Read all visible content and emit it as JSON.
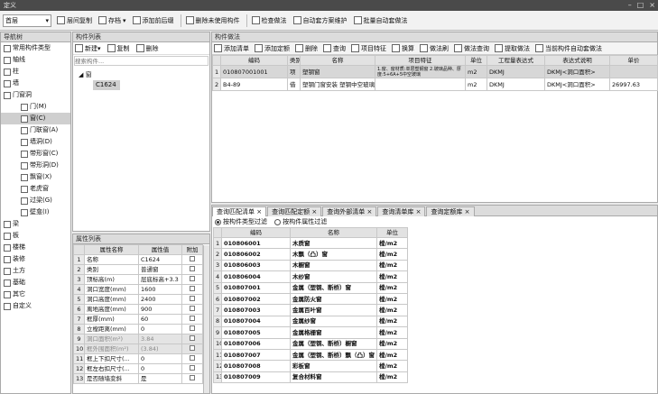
{
  "window": {
    "title": "定义"
  },
  "toolbar": {
    "floor_value": "首层",
    "buttons": [
      "层间复制",
      "存档",
      "添加前后缀",
      "删除未使用构件",
      "检查做法",
      "自动套方案维护",
      "批量自动套做法"
    ]
  },
  "nav": {
    "title": "导航树",
    "items": [
      {
        "label": "常用构件类型",
        "level": 0
      },
      {
        "label": "轴线",
        "level": 0
      },
      {
        "label": "柱",
        "level": 0
      },
      {
        "label": "墙",
        "level": 0
      },
      {
        "label": "门窗洞",
        "level": 0
      },
      {
        "label": "门(M)",
        "level": 1
      },
      {
        "label": "窗(C)",
        "level": 1
      },
      {
        "label": "门联窗(A)",
        "level": 1
      },
      {
        "label": "墙洞(D)",
        "level": 1
      },
      {
        "label": "带形窗(C)",
        "level": 1
      },
      {
        "label": "带形洞(D)",
        "level": 1
      },
      {
        "label": "飘窗(X)",
        "level": 1
      },
      {
        "label": "老虎窗",
        "level": 1
      },
      {
        "label": "过梁(G)",
        "level": 1
      },
      {
        "label": "壁龛(I)",
        "level": 1
      },
      {
        "label": "梁",
        "level": 0
      },
      {
        "label": "板",
        "level": 0
      },
      {
        "label": "楼梯",
        "level": 0
      },
      {
        "label": "装修",
        "level": 0
      },
      {
        "label": "土方",
        "level": 0
      },
      {
        "label": "基础",
        "level": 0
      },
      {
        "label": "其它",
        "level": 0
      },
      {
        "label": "自定义",
        "level": 0
      }
    ]
  },
  "component_list": {
    "title": "构件列表",
    "new_label": "新建",
    "copy_label": "复制",
    "delete_label": "删除",
    "search_placeholder": "搜索构件...",
    "tree_root": "窗",
    "selected_item": "C1624"
  },
  "properties": {
    "title": "属性列表",
    "headers": [
      "属性名称",
      "属性值",
      "附加"
    ],
    "rows": [
      {
        "n": "1",
        "name": "名称",
        "value": "C1624",
        "grey": false
      },
      {
        "n": "2",
        "name": "类别",
        "value": "普通窗",
        "grey": false
      },
      {
        "n": "3",
        "name": "顶标高(m)",
        "value": "层底标高+3.3",
        "grey": false
      },
      {
        "n": "4",
        "name": "洞口宽度(mm)",
        "value": "1600",
        "grey": false
      },
      {
        "n": "5",
        "name": "洞口高度(mm)",
        "value": "2400",
        "grey": false
      },
      {
        "n": "6",
        "name": "离地高度(mm)",
        "value": "900",
        "grey": false
      },
      {
        "n": "7",
        "name": "框厚(mm)",
        "value": "60",
        "grey": false
      },
      {
        "n": "8",
        "name": "立樘距离(mm)",
        "value": "0",
        "grey": false
      },
      {
        "n": "9",
        "name": "洞口面积(m²)",
        "value": "3.84",
        "grey": true
      },
      {
        "n": "10",
        "name": "框外围面积(m²)",
        "value": "(3.84)",
        "grey": true
      },
      {
        "n": "11",
        "name": "框上下扣尺寸(...",
        "value": "0",
        "grey": false
      },
      {
        "n": "12",
        "name": "框左右扣尺寸(...",
        "value": "0",
        "grey": false
      },
      {
        "n": "13",
        "name": "是否随墙变斜",
        "value": "是",
        "grey": false
      }
    ]
  },
  "method": {
    "title": "构件做法",
    "buttons": [
      "添加清单",
      "添加定额",
      "删除",
      "查询",
      "项目特征",
      "换算",
      "做法刷",
      "做法查询",
      "提取做法",
      "当前构件自动套做法"
    ],
    "headers": [
      "编码",
      "类别",
      "名称",
      "项目特征",
      "单位",
      "工程量表达式",
      "表达式说明",
      "单价"
    ],
    "rows": [
      {
        "n": "1",
        "code": "010807001001",
        "type": "项",
        "name": "塑钢窗",
        "feature": "1.窗、窗材质:单层塑钢窗 2.玻璃品种、厚度:5+6A+5中空玻璃",
        "unit": "m2",
        "expr": "DKMJ",
        "desc": "DKMJ<洞口面积>",
        "price": ""
      },
      {
        "n": "2",
        "code": "B4-89",
        "type": "借",
        "name": "塑钢门窗安装 塑钢中空玻璃窗",
        "feature": "",
        "unit": "m2",
        "expr": "DKMJ",
        "desc": "DKMJ<洞口面积>",
        "price": "26997.63"
      }
    ]
  },
  "query": {
    "tabs": [
      "查询匹配清单",
      "查询匹配定额",
      "查询外部清单",
      "查询清单库",
      "查询定额库"
    ],
    "filter_by_type": "按构件类型过滤",
    "filter_by_attr": "按构件属性过滤",
    "headers": [
      "编码",
      "名称",
      "单位"
    ],
    "rows": [
      {
        "n": "1",
        "code": "010806001",
        "name": "木质窗",
        "unit": "樘/m2"
      },
      {
        "n": "2",
        "code": "010806002",
        "name": "木飘（凸）窗",
        "unit": "樘/m2"
      },
      {
        "n": "3",
        "code": "010806003",
        "name": "木橱窗",
        "unit": "樘/m2"
      },
      {
        "n": "4",
        "code": "010806004",
        "name": "木纱窗",
        "unit": "樘/m2"
      },
      {
        "n": "5",
        "code": "010807001",
        "name": "金属（塑钢、断桥）窗",
        "unit": "樘/m2"
      },
      {
        "n": "6",
        "code": "010807002",
        "name": "金属防火窗",
        "unit": "樘/m2"
      },
      {
        "n": "7",
        "code": "010807003",
        "name": "金属百叶窗",
        "unit": "樘/m2"
      },
      {
        "n": "8",
        "code": "010807004",
        "name": "金属纱窗",
        "unit": "樘/m2"
      },
      {
        "n": "9",
        "code": "010807005",
        "name": "金属格栅窗",
        "unit": "樘/m2"
      },
      {
        "n": "10",
        "code": "010807006",
        "name": "金属（塑钢、断桥）橱窗",
        "unit": "樘/m2"
      },
      {
        "n": "11",
        "code": "010807007",
        "name": "金属（塑钢、断桥）飘（凸）窗",
        "unit": "樘/m2"
      },
      {
        "n": "12",
        "code": "010807008",
        "name": "彩板窗",
        "unit": "樘/m2"
      },
      {
        "n": "13",
        "code": "010807009",
        "name": "复合材料窗",
        "unit": "樘/m2"
      }
    ]
  }
}
